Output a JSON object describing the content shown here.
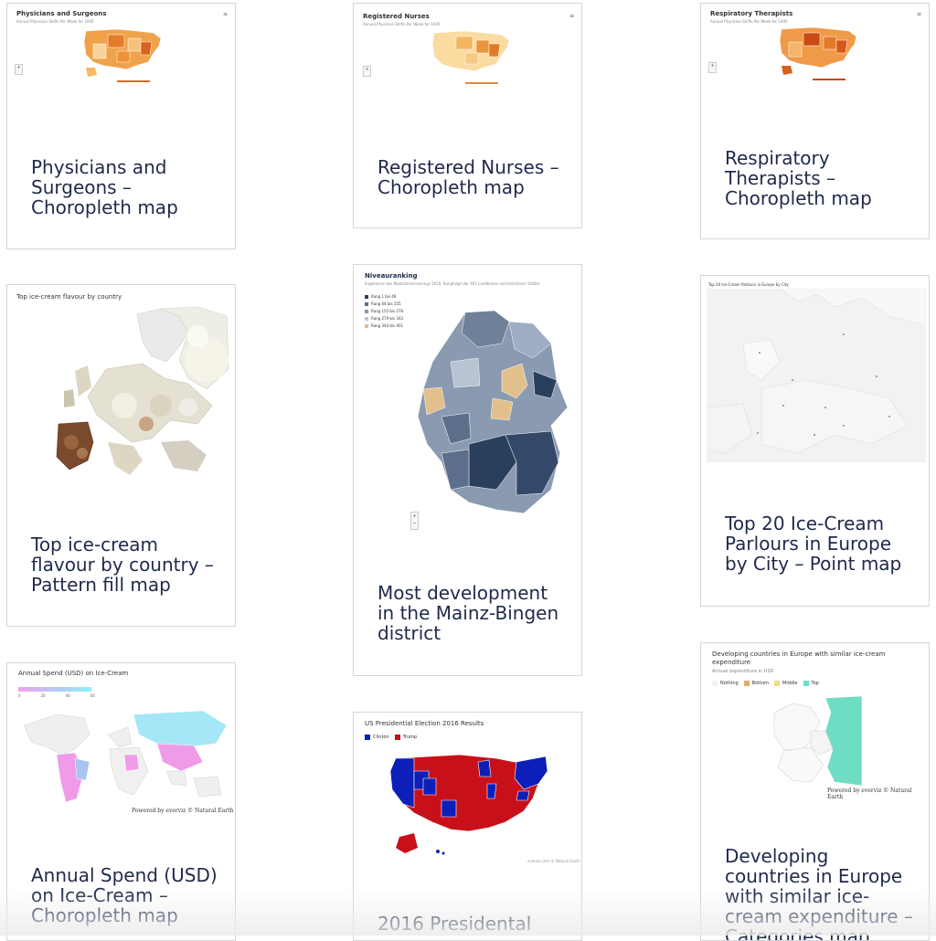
{
  "cards": {
    "physicians": {
      "thumb_title": "Physicians and Surgeons",
      "thumb_subtitle": "Annual Physician Shifts Per Week for 1000",
      "caption": "Physicians and Surgeons – Choropleth map"
    },
    "nurses": {
      "thumb_title": "Registered Nurses",
      "thumb_subtitle": "Annual Physician Shifts Per Week for 1000",
      "caption": "Registered Nurses – Choropleth map"
    },
    "respiratory": {
      "thumb_title": "Respiratory Therapists",
      "thumb_subtitle": "Annual Physician Shifts Per Week for 1000",
      "caption": "Respiratory Therapists – Choropleth map"
    },
    "icecream_flavour": {
      "thumb_title": "Top ice-cream flavour by country",
      "caption": "Top ice-cream flavour by country – Pattern fill map"
    },
    "mainz": {
      "thumb_title": "Niveauranking",
      "thumb_subtitle": "Ergebnisse des Wohlstandsrankings 2020, Rangfolge der 401 Landkreise und kreisfreien Städte",
      "legend": [
        {
          "label": "Rang 1 bis 46",
          "color": "#2a3f5c"
        },
        {
          "label": "Rang 64 bis 155",
          "color": "#5c6f8a"
        },
        {
          "label": "Rang 155 bis 278",
          "color": "#8a9ab0"
        },
        {
          "label": "Rang 279 bis 343",
          "color": "#b8c3d3"
        },
        {
          "label": "Rang 344 bis 401",
          "color": "#e2c08c"
        }
      ],
      "caption": "Most development in the Mainz-Bingen district"
    },
    "parlours": {
      "thumb_title": "Top 20 Ice-Cream Parlours in Europe by City",
      "caption": "Top 20 Ice-Cream Parlours in Europe by City – Point map"
    },
    "annual_spend": {
      "thumb_title": "Annual Spend (USD) on Ice-Cream",
      "scale_ticks": [
        "0",
        "20",
        "40",
        "60"
      ],
      "credit": "Powered by everviz © Natural Earth",
      "caption": "Annual Spend (USD) on Ice-Cream – Choropleth map"
    },
    "election": {
      "thumb_title": "US Presidential Election 2016 Results",
      "legend": [
        {
          "label": "Clinton",
          "color": "#0c1fb8"
        },
        {
          "label": "Trump",
          "color": "#c8101a"
        }
      ],
      "credit": "everviz.com © Natural Earth",
      "caption": "2016 Presidental"
    },
    "developing": {
      "thumb_title": "Developing countries in Europe with similar ice-cream expenditure",
      "thumb_subtitle": "Annual expenditure in USD",
      "legend": [
        {
          "label": "Nothing",
          "color": "#f2f2f2"
        },
        {
          "label": "Bottom",
          "color": "#e8a96a"
        },
        {
          "label": "Middle",
          "color": "#f0df8a"
        },
        {
          "label": "Top",
          "color": "#6fdcc4"
        }
      ],
      "credit": "Powered by everviz © Natural Earth",
      "caption": "Developing countries in Europe with similar ice-cream expenditure – Categories map"
    }
  },
  "icons": {
    "menu": "hamburger-menu-icon",
    "zoom_in": "plus-icon",
    "zoom_out": "minus-icon"
  }
}
